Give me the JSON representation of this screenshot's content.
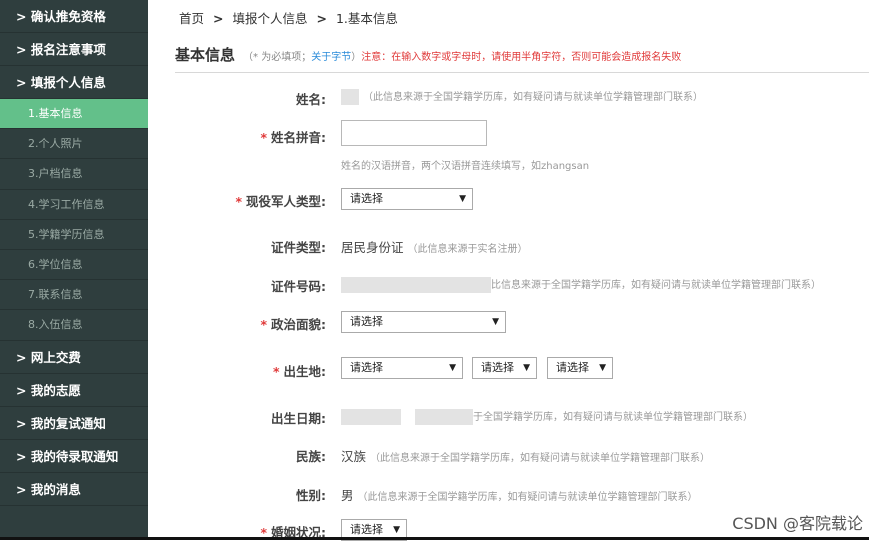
{
  "sidebar": {
    "items": [
      {
        "label": "> 确认推免资格",
        "type": "main"
      },
      {
        "label": "> 报名注意事项",
        "type": "main"
      },
      {
        "label": "> 填报个人信息",
        "type": "main"
      },
      {
        "label": "1.基本信息",
        "type": "sub",
        "active": true
      },
      {
        "label": "2.个人照片",
        "type": "sub"
      },
      {
        "label": "3.户档信息",
        "type": "sub"
      },
      {
        "label": "4.学习工作信息",
        "type": "sub"
      },
      {
        "label": "5.学籍学历信息",
        "type": "sub"
      },
      {
        "label": "6.学位信息",
        "type": "sub"
      },
      {
        "label": "7.联系信息",
        "type": "sub"
      },
      {
        "label": "8.入伍信息",
        "type": "sub"
      },
      {
        "label": "> 网上交费",
        "type": "main"
      },
      {
        "label": "> 我的志愿",
        "type": "main"
      },
      {
        "label": "> 我的复试通知",
        "type": "main"
      },
      {
        "label": "> 我的待录取通知",
        "type": "main"
      },
      {
        "label": "> 我的消息",
        "type": "main"
      }
    ]
  },
  "breadcrumb": {
    "home": "首页",
    "sep": ">",
    "level2": "填报个人信息",
    "level3": "1.基本信息"
  },
  "header": {
    "title": "基本信息",
    "required_note": "（* 为必填项；",
    "link_label": "关于字节",
    "close_paren": "）",
    "warning": "注意：在输入数字或字母时，请使用半角字符，否则可能会造成报名失败"
  },
  "form": {
    "name": {
      "label": "姓名:",
      "hint": "（此信息来源于全国学籍学历库，如有疑问请与就读单位学籍管理部门联系）"
    },
    "pinyin": {
      "label": "姓名拼音:",
      "hint": "姓名的汉语拼音，两个汉语拼音连续填写，如zhangsan"
    },
    "military": {
      "label": "现役军人类型:",
      "selected": "请选择"
    },
    "id_type": {
      "label": "证件类型:",
      "value": "居民身份证",
      "hint": "（此信息来源于实名注册）"
    },
    "id_number": {
      "label": "证件号码:",
      "hint": "比信息来源于全国学籍学历库，如有疑问请与就读单位学籍管理部门联系）"
    },
    "political": {
      "label": "政治面貌:",
      "selected": "请选择"
    },
    "birthplace": {
      "label": "出生地:",
      "select1": "请选择",
      "select2": "请选择",
      "select3": "请选择"
    },
    "birthdate": {
      "label": "出生日期:",
      "hint": "于全国学籍学历库，如有疑问请与就读单位学籍管理部门联系）"
    },
    "ethnicity": {
      "label": "民族:",
      "value": "汉族",
      "hint": "（此信息来源于全国学籍学历库，如有疑问请与就读单位学籍管理部门联系）"
    },
    "gender": {
      "label": "性别:",
      "value": "男",
      "hint": "（此信息来源于全国学籍学历库，如有疑问请与就读单位学籍管理部门联系）"
    },
    "marital": {
      "label": "婚姻状况:",
      "selected": "请选择"
    }
  },
  "watermark": "CSDN @客院载论",
  "icons": {
    "dropdown": "chevron-down-icon",
    "required": "asterisk-icon"
  },
  "colors": {
    "sidebar_bg": "#2f3e3e",
    "active_bg": "#63c08a",
    "required": "#e03a3a",
    "link": "#2a8bd9"
  }
}
